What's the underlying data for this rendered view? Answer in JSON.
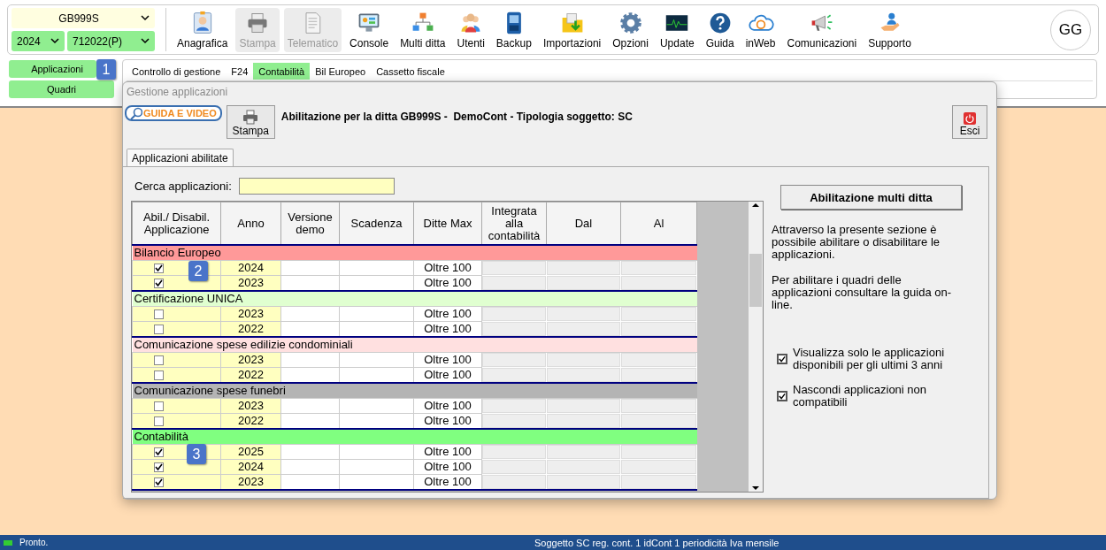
{
  "header": {
    "company_select": "GB999S",
    "year_select": "2024",
    "period_select": "712022(P)",
    "toolbar": [
      {
        "label": "Anagrafica",
        "kind": "profile",
        "disabled": false
      },
      {
        "label": "Stampa",
        "kind": "printer",
        "disabled": true
      },
      {
        "label": "Telematico",
        "kind": "document",
        "disabled": true
      },
      {
        "label": "Console",
        "kind": "monitor",
        "disabled": false
      },
      {
        "label": "Multi ditta",
        "kind": "network",
        "disabled": false
      },
      {
        "label": "Utenti",
        "kind": "people",
        "disabled": false
      },
      {
        "label": "Backup",
        "kind": "disk",
        "disabled": false
      },
      {
        "label": "Importazioni",
        "kind": "folder",
        "disabled": false
      },
      {
        "label": "Opzioni",
        "kind": "gear",
        "disabled": false
      },
      {
        "label": "Update",
        "kind": "pulse",
        "disabled": false
      },
      {
        "label": "Guida",
        "kind": "help",
        "disabled": false
      },
      {
        "label": "inWeb",
        "kind": "cloud",
        "disabled": false
      },
      {
        "label": "Comunicazioni",
        "kind": "megaphone",
        "disabled": false
      },
      {
        "label": "Supporto",
        "kind": "hand",
        "disabled": false
      }
    ],
    "avatar": "GG"
  },
  "side_buttons": [
    "Applicazioni",
    "Quadri"
  ],
  "module_tabs": [
    {
      "label": "Controllo di gestione",
      "selected": false
    },
    {
      "label": "F24",
      "selected": false
    },
    {
      "label": "Contabilità",
      "selected": true
    },
    {
      "label": "Bil Europeo",
      "selected": false
    },
    {
      "label": "Cassetto fiscale",
      "selected": false
    }
  ],
  "dialog": {
    "title": "Gestione applicazioni",
    "guide_button": "GUIDA E VIDEO",
    "print_button": "Stampa",
    "heading": "Abilitazione per la ditta GB999S -  DemoCont - Tipologia soggetto: SC",
    "exit_button": "Esci",
    "tabs": [
      {
        "label": "Applicazioni abilitate",
        "selected": true
      }
    ],
    "search": {
      "label": "Cerca applicazioni:"
    },
    "table": {
      "columns": [
        "Abil./ Disabil. Applicazione",
        "Anno",
        "Versione demo",
        "Scadenza",
        "Ditte Max",
        "Integrata alla contabilità",
        "Dal",
        "Al"
      ],
      "groups": [
        {
          "name": "Bilancio Europeo",
          "color": "#ff9999",
          "rows": [
            {
              "enabled": true,
              "year": "2024",
              "max": "Oltre 100"
            },
            {
              "enabled": true,
              "year": "2023",
              "max": "Oltre 100"
            }
          ]
        },
        {
          "name": "Certificazione UNICA",
          "color": "#e0ffd0",
          "rows": [
            {
              "enabled": false,
              "year": "2023",
              "max": "Oltre 100"
            },
            {
              "enabled": false,
              "year": "2022",
              "max": "Oltre 100"
            }
          ]
        },
        {
          "name": "Comunicazione spese edilizie condominiali",
          "color": "#ffe0e0",
          "rows": [
            {
              "enabled": false,
              "year": "2023",
              "max": "Oltre 100"
            },
            {
              "enabled": false,
              "year": "2022",
              "max": "Oltre 100"
            }
          ]
        },
        {
          "name": "Comunicazione spese funebri",
          "color": "#b4b4b4",
          "rows": [
            {
              "enabled": false,
              "year": "2023",
              "max": "Oltre 100"
            },
            {
              "enabled": false,
              "year": "2022",
              "max": "Oltre 100"
            }
          ]
        },
        {
          "name": "Contabilità",
          "color": "#80ff80",
          "rows": [
            {
              "enabled": true,
              "year": "2025",
              "max": "Oltre 100"
            },
            {
              "enabled": true,
              "year": "2024",
              "max": "Oltre 100"
            },
            {
              "enabled": true,
              "year": "2023",
              "max": "Oltre 100"
            }
          ]
        }
      ]
    },
    "multi_button": "Abilitazione multi ditta",
    "info": [
      "Attraverso la presente sezione è possibile abilitare o disabilitare le applicazioni.",
      "Per abilitare i quadri delle applicazioni consultare la guida on-line."
    ],
    "options": [
      {
        "label": "Visualizza solo le applicazioni disponibili per gli ultimi 3 anni",
        "checked": true
      },
      {
        "label": "Nascondi applicazioni non compatibili",
        "checked": true
      }
    ]
  },
  "markers": [
    "1",
    "2",
    "3"
  ],
  "status_bar": {
    "left": "Pronto.",
    "center": "Soggetto SC reg. cont. 1 idCont 1 periodicità Iva mensile"
  }
}
